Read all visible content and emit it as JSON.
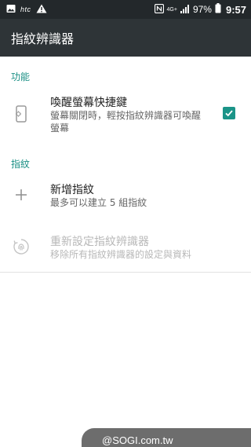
{
  "status_bar": {
    "carrier_brand": "htc",
    "network_type": "4G+",
    "battery_percent": "97%",
    "time": "9:57",
    "icons": [
      "image-icon",
      "warning-icon",
      "nfc-icon",
      "signal-icon",
      "battery-icon"
    ]
  },
  "app_bar": {
    "title": "指紋辨識器"
  },
  "sections": {
    "function_header": "功能",
    "fingerprint_header": "指紋"
  },
  "wake_screen": {
    "title": "喚醒螢幕快捷鍵",
    "subtitle": "螢幕關閉時，輕按指紋辨識器可喚醒螢幕",
    "checked": true,
    "icon": "phone-wake-icon"
  },
  "add_fingerprint": {
    "title": "新增指紋",
    "subtitle": "最多可以建立 5 組指紋",
    "icon": "plus-icon"
  },
  "reset_sensor": {
    "title": "重新設定指紋辨識器",
    "subtitle": "移除所有指紋辨識器的設定與資料",
    "icon": "fingerprint-reset-icon",
    "enabled": false
  },
  "watermark": {
    "text": "@SOGI.com.tw"
  },
  "colors": {
    "accent": "#1b9488",
    "status_bar": "#23282b",
    "app_bar": "#2e3437"
  }
}
